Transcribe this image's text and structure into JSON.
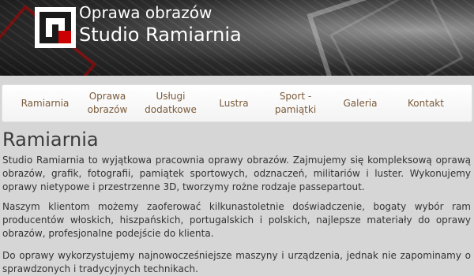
{
  "header": {
    "title_line1": "Oprawa obrazów",
    "title_line2": "Studio Ramiarnia",
    "logo_icon": "studio-logo-icon",
    "logo_colors": {
      "frame": "#ffffff",
      "accent": "#cc0000"
    }
  },
  "nav": {
    "items": [
      {
        "label": "Ramiarnia"
      },
      {
        "label": "Oprawa obrazów"
      },
      {
        "label": "Usługi dodatkowe"
      },
      {
        "label": "Lustra"
      },
      {
        "label": "Sport - pamiątki"
      },
      {
        "label": "Galeria"
      },
      {
        "label": "Kontakt"
      }
    ],
    "link_color": "#7a5a3a"
  },
  "main": {
    "heading": "Ramiarnia",
    "paragraphs": [
      "Studio Ramiarnia to wyjątkowa pracownia oprawy obrazów. Zajmujemy się kompleksową oprawą obrazów, grafik, fotografii, pamiątek sportowych, odznaczeń, militariów i luster. Wykonujemy oprawy nietypowe i przestrzenne 3D, tworzymy rożne rodzaje passepartout.",
      "Naszym klientom możemy zaoferować kilkunastoletnie doświadczenie, bogaty wybór ram producentów włoskich, hiszpańskich, portugalskich i polskich,  najlepsze materiały do oprawy obrazów,  profesjonalne podejście do klienta.",
      "Do oprawy wykorzystujemy najnowocześniejsze maszyny i urządzenia, jednak nie zapominamy o sprawdzonych i tradycyjnych technikach."
    ]
  }
}
